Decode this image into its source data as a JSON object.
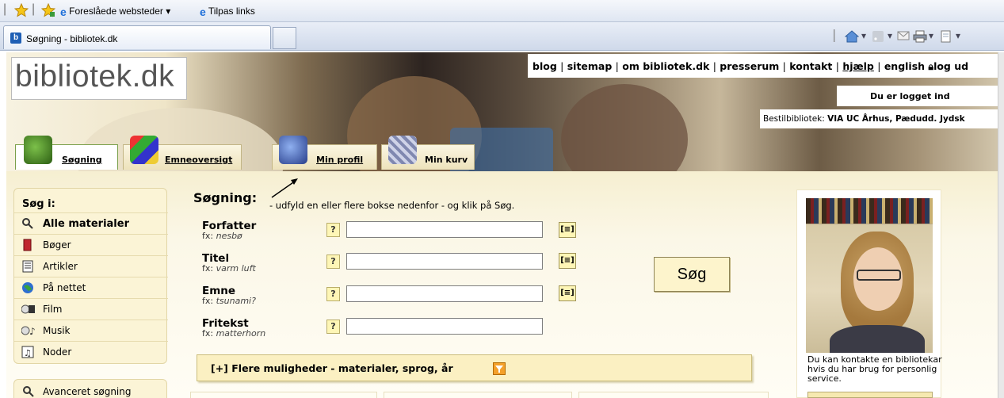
{
  "browser": {
    "favorites_bar": {
      "suggested_sites": "Foreslåede websteder ▾",
      "custom_links": "Tilpas links"
    },
    "tab": {
      "title": "Søgning - bibliotek.dk",
      "favicon": "b"
    },
    "command_bar_icons": [
      "home-icon",
      "feeds-icon",
      "read-mail-icon",
      "print-icon",
      "page-icon"
    ]
  },
  "header": {
    "logo": "bibliotek.dk",
    "top_links": [
      "blog",
      "sitemap",
      "om bibliotek.dk",
      "presserum",
      "kontakt",
      "hjælp",
      "english",
      "log ud"
    ],
    "logged_in": "Du er logget ind",
    "order_library_label": "Bestilbibliotek:",
    "order_library_value": "VIA UC Århus, Pædudd. Jydsk"
  },
  "nav": {
    "tabs": [
      {
        "label": "Søgning",
        "icon": "search-cube-icon"
      },
      {
        "label": "Emneoversigt",
        "icon": "topics-cube-icon"
      },
      {
        "label": "Min profil",
        "icon": "profile-cube-icon"
      },
      {
        "label": "Min kurv",
        "icon": "basket-cube-icon"
      }
    ]
  },
  "sidebar": {
    "title": "Søg i:",
    "items": [
      {
        "label": "Alle materialer",
        "icon": "magnifier-icon"
      },
      {
        "label": "Bøger",
        "icon": "book-icon"
      },
      {
        "label": "Artikler",
        "icon": "article-icon"
      },
      {
        "label": "På nettet",
        "icon": "globe-icon"
      },
      {
        "label": "Film",
        "icon": "film-icon"
      },
      {
        "label": "Musik",
        "icon": "music-icon"
      },
      {
        "label": "Noder",
        "icon": "sheet-music-icon"
      }
    ],
    "advanced_search": "Avanceret søgning"
  },
  "search": {
    "title": "Søgning:",
    "hint": "- udfyld en eller flere bokse nedenfor - og klik på Søg.",
    "fields": [
      {
        "label": "Forfatter",
        "example_prefix": "fx:",
        "example": "nesbø",
        "value": "",
        "has_list": true
      },
      {
        "label": "Titel",
        "example_prefix": "fx:",
        "example": "varm luft",
        "value": "",
        "has_list": true
      },
      {
        "label": "Emne",
        "example_prefix": "fx:",
        "example": "tsunami?",
        "value": "",
        "has_list": true
      },
      {
        "label": "Fritekst",
        "example_prefix": "fx:",
        "example": "matterhorn",
        "value": "",
        "has_list": false
      }
    ],
    "help_label": "?",
    "list_label": "[≡]",
    "submit": "Søg",
    "more_options": "[+] Flere muligheder - materialer, sprog, år"
  },
  "contact": {
    "text": "Du kan kontakte en bibliotekar hvis du har brug for personlig service."
  },
  "colors": {
    "panel": "#fbf4d6",
    "button": "#fdf4cc",
    "accent": "#f4a02a"
  }
}
